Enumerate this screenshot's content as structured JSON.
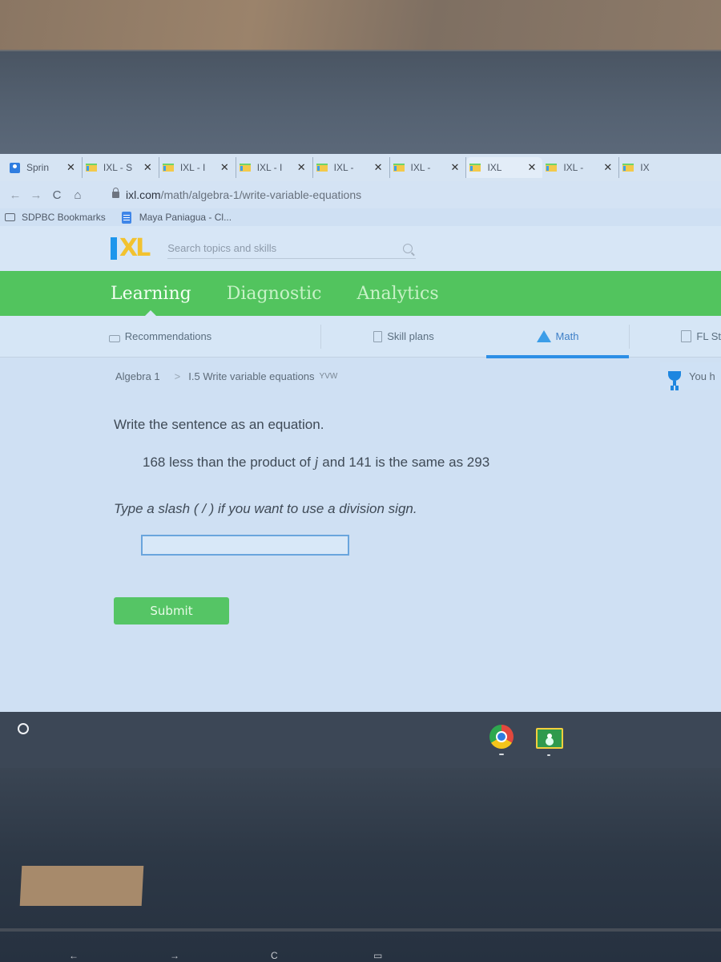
{
  "browser": {
    "tabs": [
      {
        "title": "Sprin",
        "icon": "person-icon"
      },
      {
        "title": "IXL - S",
        "icon": "ixl-favicon"
      },
      {
        "title": "IXL - I",
        "icon": "ixl-favicon"
      },
      {
        "title": "IXL - I",
        "icon": "ixl-favicon"
      },
      {
        "title": "IXL - ",
        "icon": "ixl-favicon"
      },
      {
        "title": "IXL - ",
        "icon": "ixl-favicon"
      },
      {
        "title": "IXL",
        "icon": "ixl-favicon",
        "active": true
      },
      {
        "title": "IXL - ",
        "icon": "ixl-favicon"
      },
      {
        "title": "IX",
        "icon": "ixl-favicon"
      }
    ],
    "close_glyph": "✕",
    "nav": {
      "back": "←",
      "forward": "→",
      "reload": "C",
      "home": "⌂"
    },
    "url_host": "ixl.com",
    "url_path": "/math/algebra-1/write-variable-equations",
    "bookmarks": [
      {
        "label": "SDPBC Bookmarks",
        "icon": "folder-icon"
      },
      {
        "label": "Maya Paniagua - Cl...",
        "icon": "docs-icon"
      }
    ]
  },
  "ixl": {
    "logo_text": "XL",
    "search_placeholder": "Search topics and skills",
    "main_tabs": [
      {
        "label": "Learning",
        "active": true
      },
      {
        "label": "Diagnostic"
      },
      {
        "label": "Analytics"
      }
    ],
    "sub_tabs": [
      {
        "label": "Recommendations"
      },
      {
        "label": "Skill plans"
      },
      {
        "label": "Math",
        "active": true
      },
      {
        "label": "FL St"
      }
    ],
    "breadcrumb": {
      "course": "Algebra 1",
      "separator": ">",
      "skill": "I.5 Write variable equations",
      "code": "YVW"
    },
    "award_text": "You h",
    "question": {
      "instruction": "Write the sentence as an equation.",
      "sentence_before": "168 less than the product of ",
      "variable": "j",
      "sentence_after": " and 141 is the same as 293",
      "hint": "Type a slash ( / ) if you want to use a division sign.",
      "answer_value": "",
      "submit_label": "Submit"
    }
  },
  "shelf": {
    "apps": [
      "chrome-icon",
      "google-classroom-icon"
    ]
  },
  "colors": {
    "ixl_green": "#52c45e",
    "ixl_blue": "#1d96ec",
    "ixl_yellow": "#f2c230",
    "active_tab_underline": "#2d8fe6"
  },
  "keyboard_glyphs": [
    "←",
    "→",
    "C",
    "▭"
  ]
}
